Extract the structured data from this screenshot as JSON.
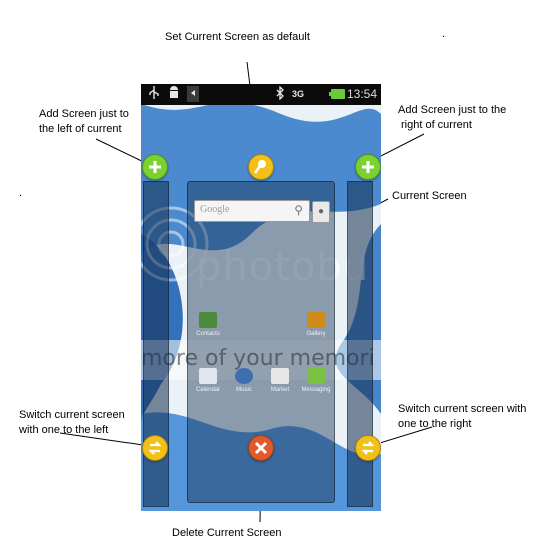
{
  "annotations": {
    "set_default": "Set Current Screen as default",
    "add_left_1": "Add Screen just to",
    "add_left_2": "the left of current",
    "add_right_1": "Add Screen just to the",
    "add_right_2": "right of current",
    "current_screen": "Current Screen",
    "switch_left_1": "Switch current screen",
    "switch_left_2": "with one to the left",
    "switch_right_1": "Switch current screen with",
    "switch_right_2": "one to the right",
    "delete": "Delete Current Screen"
  },
  "status_bar": {
    "time": "13:54",
    "network": "3G",
    "left_icons": [
      "usb-icon",
      "android-debug-icon",
      "back-icon"
    ],
    "right_icons": [
      "bluetooth-icon",
      "network-icon",
      "battery-icon"
    ]
  },
  "search_widget": {
    "placeholder": "Google"
  },
  "apps": [
    {
      "label": "Contacts",
      "icon": "contacts-icon",
      "color": "#4b8a3a"
    },
    {
      "label": "Gallery",
      "icon": "gallery-icon",
      "color": "#d08a1a"
    },
    {
      "label": "Calendar",
      "icon": "calendar-icon",
      "color": "#dfe6ee"
    },
    {
      "label": "Music",
      "icon": "music-icon",
      "color": "#3d6fb0"
    },
    {
      "label": "Market",
      "icon": "market-icon",
      "color": "#e8e8e8"
    },
    {
      "label": "Messaging",
      "icon": "messaging-icon",
      "color": "#7ac143"
    }
  ],
  "watermark": {
    "brand": "photobu",
    "tagline": "more of your memori"
  },
  "controls": [
    {
      "name": "add-screen-left-button",
      "icon": "plus-icon",
      "color": "#7ad12f"
    },
    {
      "name": "set-default-button",
      "icon": "pin-icon",
      "color": "#f2c118"
    },
    {
      "name": "add-screen-right-button",
      "icon": "plus-icon",
      "color": "#7ad12f"
    },
    {
      "name": "swap-left-button",
      "icon": "swap-icon",
      "color": "#f2c118"
    },
    {
      "name": "delete-screen-button",
      "icon": "close-icon",
      "color": "#e05a2a"
    },
    {
      "name": "swap-right-button",
      "icon": "swap-icon",
      "color": "#f2c118"
    }
  ]
}
